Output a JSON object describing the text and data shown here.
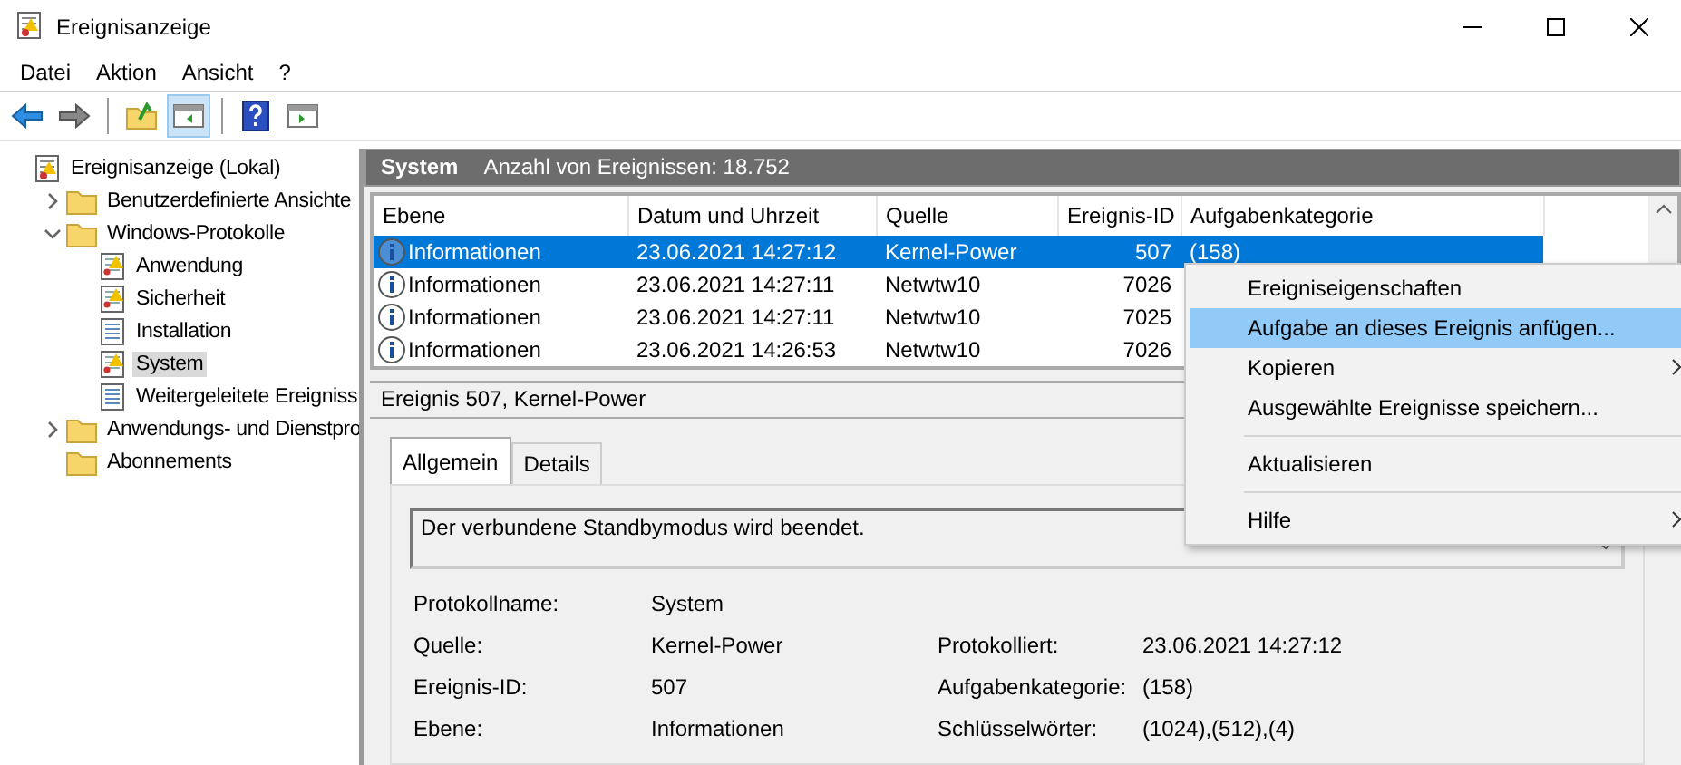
{
  "window": {
    "title": "Ereignisanzeige"
  },
  "menu": [
    "Datei",
    "Aktion",
    "Ansicht",
    "?"
  ],
  "toolbar": [
    {
      "kind": "back"
    },
    {
      "kind": "forward"
    },
    {
      "kind": "sep"
    },
    {
      "kind": "up",
      "selected": false
    },
    {
      "kind": "pane-left",
      "selected": true
    },
    {
      "kind": "sep"
    },
    {
      "kind": "help",
      "selected": false
    },
    {
      "kind": "pane-right",
      "selected": false
    }
  ],
  "tree": [
    {
      "label": "Ereignisanzeige (Lokal)",
      "kind": "viewer",
      "selected": false,
      "children": [
        {
          "label": "Benutzerdefinierte Ansichte",
          "kind": "folder",
          "expanded": false,
          "selected": false
        },
        {
          "label": "Windows-Protokolle",
          "kind": "folder",
          "expanded": true,
          "selected": false,
          "children": [
            {
              "label": "Anwendung",
              "kind": "log-alert",
              "selected": false
            },
            {
              "label": "Sicherheit",
              "kind": "log-alert",
              "selected": false
            },
            {
              "label": "Installation",
              "kind": "log",
              "selected": false
            },
            {
              "label": "System",
              "kind": "log-alert",
              "selected": true
            },
            {
              "label": "Weitergeleitete Ereigniss",
              "kind": "log",
              "selected": false
            }
          ]
        },
        {
          "label": "Anwendungs- und Dienstpro",
          "kind": "folder",
          "expanded": false,
          "selected": false
        },
        {
          "label": "Abonnements",
          "kind": "folder",
          "selected": false
        }
      ]
    }
  ],
  "log_header": {
    "name": "System",
    "count": "Anzahl von Ereignissen: 18.752"
  },
  "table": {
    "columns": [
      "Ebene",
      "Datum und Uhrzeit",
      "Quelle",
      "Ereignis-ID",
      "Aufgabenkategorie"
    ],
    "rows": [
      {
        "cells": [
          "Informationen",
          "23.06.2021 14:27:12",
          "Kernel-Power",
          "507",
          "(158)"
        ],
        "selected": true
      },
      {
        "cells": [
          "Informationen",
          "23.06.2021 14:27:11",
          "Netwtw10",
          "7026"
        ],
        "selected": false
      },
      {
        "cells": [
          "Informationen",
          "23.06.2021 14:27:11",
          "Netwtw10",
          "7025"
        ],
        "selected": false
      },
      {
        "cells": [
          "Informationen",
          "23.06.2021 14:26:53",
          "Netwtw10",
          "7026"
        ],
        "selected": false
      }
    ]
  },
  "details": {
    "title": "Ereignis 507, Kernel-Power",
    "tabs": [
      {
        "label": "Allgemein",
        "selected": true
      },
      {
        "label": "Details",
        "selected": false
      }
    ],
    "message": "Der verbundene Standbymodus wird beendet.",
    "fields": [
      [
        {
          "label": "Protokollname:",
          "value": "System"
        }
      ],
      [
        {
          "label": "Quelle:",
          "value": "Kernel-Power"
        },
        {
          "label": "Protokolliert:",
          "value": "23.06.2021 14:27:12"
        }
      ],
      [
        {
          "label": "Ereignis-ID:",
          "value": "507"
        },
        {
          "label": "Aufgabenkategorie:",
          "value": "(158)"
        }
      ],
      [
        {
          "label": "Ebene:",
          "value": "Informationen"
        },
        {
          "label": "Schlüsselwörter:",
          "value": "(1024),(512),(4)"
        }
      ]
    ]
  },
  "context_menu": [
    {
      "kind": "item",
      "label": "Ereigniseigenschaften",
      "selected": false,
      "submenu": false
    },
    {
      "kind": "item",
      "label": "Aufgabe an dieses Ereignis anfügen...",
      "selected": true,
      "submenu": false
    },
    {
      "kind": "item",
      "label": "Kopieren",
      "selected": false,
      "submenu": true
    },
    {
      "kind": "item",
      "label": "Ausgewählte Ereignisse speichern...",
      "selected": false,
      "submenu": false
    },
    {
      "kind": "separator"
    },
    {
      "kind": "item",
      "label": "Aktualisieren",
      "selected": false,
      "submenu": false
    },
    {
      "kind": "separator"
    },
    {
      "kind": "item",
      "label": "Hilfe",
      "selected": false,
      "submenu": true
    }
  ]
}
